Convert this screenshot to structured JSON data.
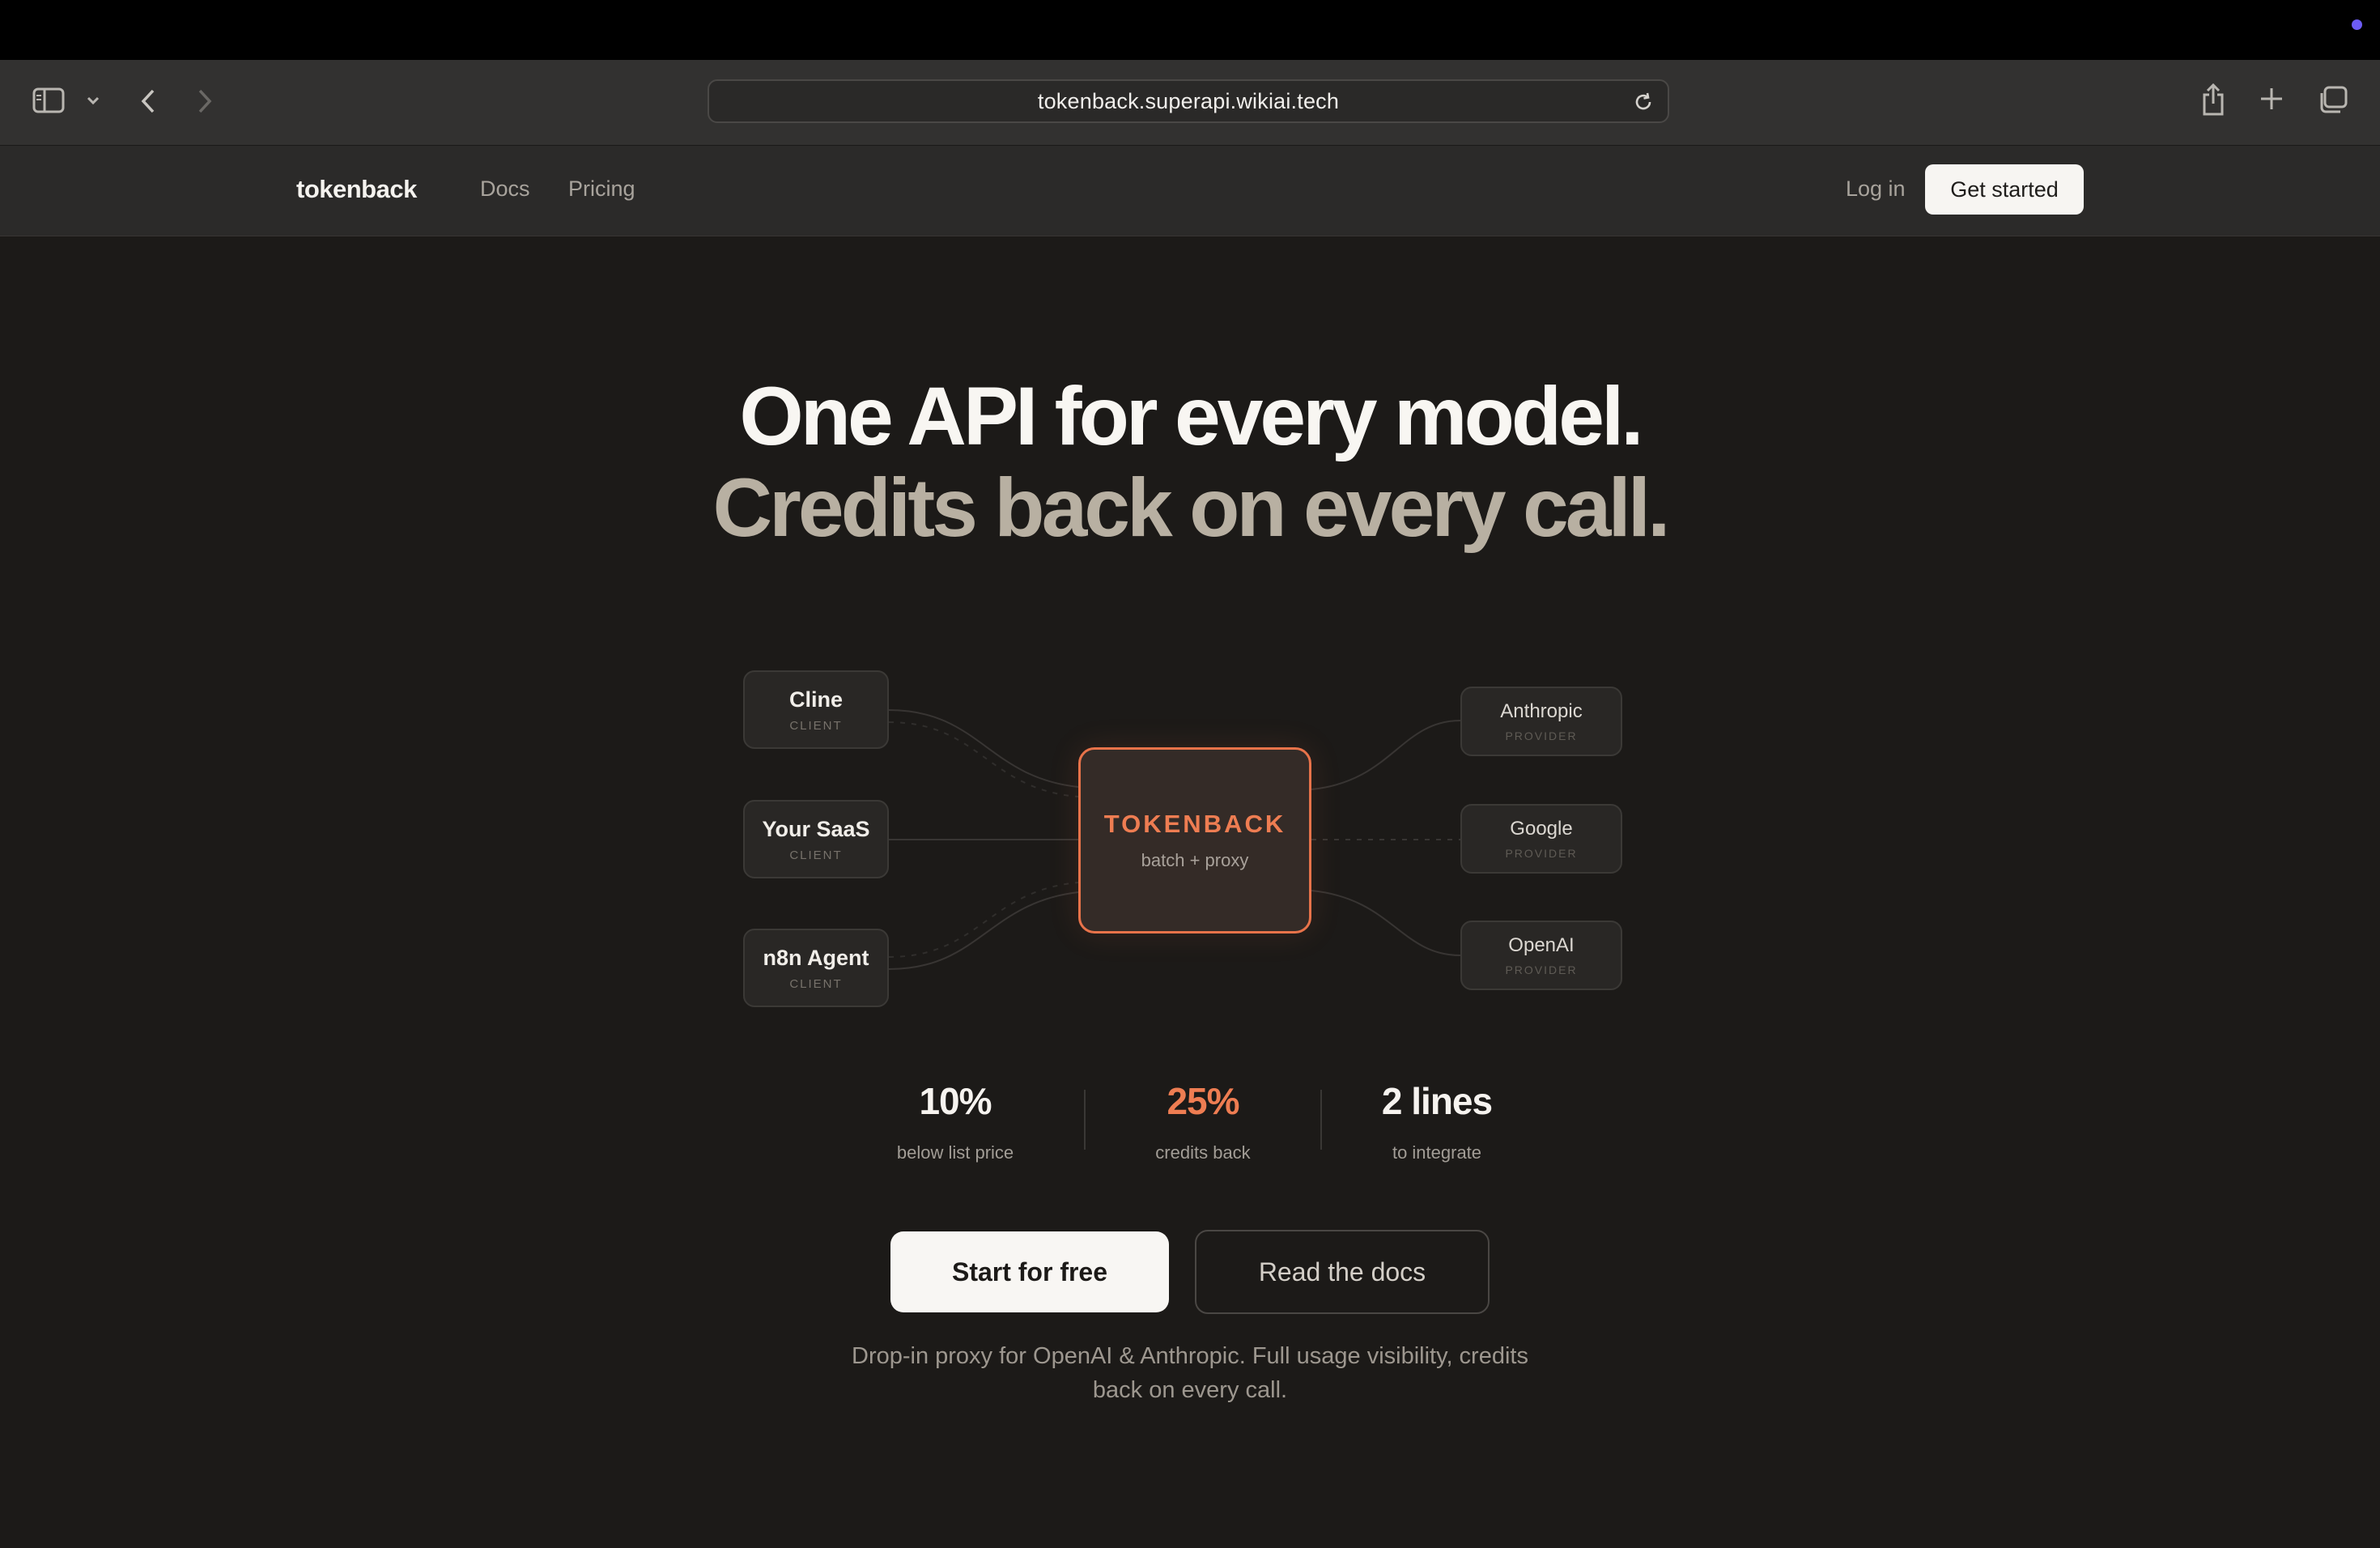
{
  "browser": {
    "url": "tokenback.superapi.wikiai.tech",
    "icons": [
      "sidebar-icon",
      "chevron-down-icon",
      "back-icon",
      "forward-icon",
      "reload-icon",
      "share-icon",
      "plus-icon",
      "tabs-icon"
    ]
  },
  "nav": {
    "logo": "tokenback",
    "links": [
      "Docs",
      "Pricing"
    ],
    "login": "Log in",
    "cta": "Get started"
  },
  "hero": {
    "line1": "One API for every model.",
    "line2": "Credits back on every call."
  },
  "diagram": {
    "clients": [
      {
        "name": "Cline",
        "tag": "CLIENT"
      },
      {
        "name": "Your SaaS",
        "tag": "CLIENT"
      },
      {
        "name": "n8n Agent",
        "tag": "CLIENT"
      }
    ],
    "hub": {
      "title": "TOKENBACK",
      "subtitle": "batch + proxy"
    },
    "providers": [
      {
        "name": "Anthropic",
        "tag": "PROVIDER"
      },
      {
        "name": "Google",
        "tag": "PROVIDER"
      },
      {
        "name": "OpenAI",
        "tag": "PROVIDER"
      }
    ]
  },
  "stats": [
    {
      "value": "10%",
      "label": "below list price"
    },
    {
      "value": "25%",
      "label": "credits back"
    },
    {
      "value": "2 lines",
      "label": "to integrate"
    }
  ],
  "cta": {
    "primary": "Start for free",
    "secondary": "Read the docs"
  },
  "tagline": "Drop-in proxy for OpenAI & Anthropic. Full usage visibility, credits back on every call.",
  "colors": {
    "accent": "#ee7d52",
    "background": "#1c1a18",
    "hero_muted": "#b8b0a2"
  }
}
